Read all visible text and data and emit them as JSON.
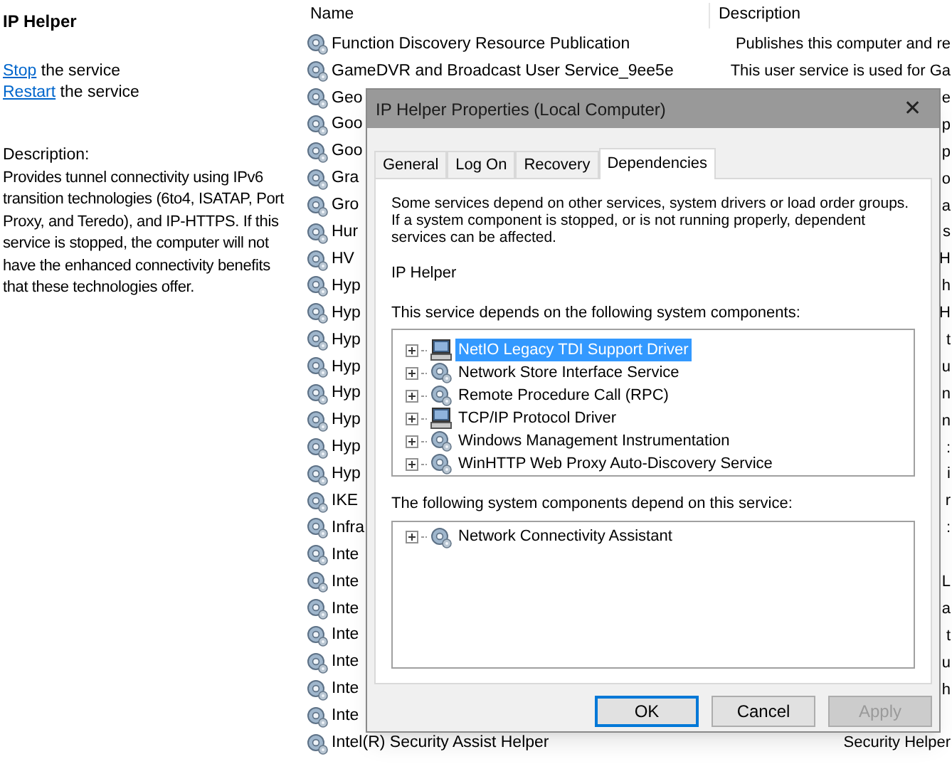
{
  "details": {
    "title": "IP Helper",
    "actions": [
      {
        "link": "Stop",
        "text": "the service"
      },
      {
        "link": "Restart",
        "text": "the service"
      }
    ],
    "description_label": "Description:",
    "description": "Provides tunnel connectivity using IPv6 transition technologies (6to4, ISATAP, Port Proxy, and Teredo), and IP-HTTPS. If this service is stopped, the computer will not have the enhanced connectivity benefits that these technologies offer."
  },
  "services": {
    "columns": [
      "Name",
      "Description"
    ],
    "rows": [
      {
        "name": "Function Discovery Resource Publication",
        "description": "Publishes this computer and re"
      },
      {
        "name": "GameDVR and Broadcast User Service_9ee5e",
        "description": "This user service is used for Ga"
      },
      {
        "name": "Geo",
        "description": "e"
      },
      {
        "name": "Goo",
        "description": "p"
      },
      {
        "name": "Goo",
        "description": "p"
      },
      {
        "name": "Gra",
        "description": "o"
      },
      {
        "name": "Gro",
        "description": "a"
      },
      {
        "name": "Hur",
        "description": "s"
      },
      {
        "name": "HV",
        "description": "H"
      },
      {
        "name": "Hyp",
        "description": "h"
      },
      {
        "name": "Hyp",
        "description": "H"
      },
      {
        "name": "Hyp",
        "description": "t"
      },
      {
        "name": "Hyp",
        "description": "u"
      },
      {
        "name": "Hyp",
        "description": "n"
      },
      {
        "name": "Hyp",
        "description": "n"
      },
      {
        "name": "Hyp",
        "description": ":"
      },
      {
        "name": "Hyp",
        "description": "i"
      },
      {
        "name": "IKE",
        "description": "r"
      },
      {
        "name": "Infra",
        "description": ":"
      },
      {
        "name": "Inte"
      },
      {
        "name": "Inte",
        "description": "L"
      },
      {
        "name": "Inte",
        "description": "a"
      },
      {
        "name": "Inte",
        "description": "t"
      },
      {
        "name": "Inte",
        "description": "u"
      },
      {
        "name": "Inte",
        "description": "h"
      },
      {
        "name": "Inte"
      },
      {
        "name": "Intel(R) Security Assist Helper",
        "description": "Security Helper"
      }
    ]
  },
  "dialog": {
    "title": "IP Helper Properties (Local Computer)",
    "close": "✕",
    "tabs": [
      {
        "label": "General",
        "selected": false
      },
      {
        "label": "Log On",
        "selected": false
      },
      {
        "label": "Recovery",
        "selected": false
      },
      {
        "label": "Dependencies",
        "selected": true
      }
    ],
    "intro": "Some services depend on other services, system drivers or load order groups. If a system component is stopped, or is not running properly, dependent services can be affected.",
    "service_name": "IP Helper",
    "depends_on_label": "This service depends on the following system components:",
    "depends_on": [
      {
        "kind": "driver",
        "label": "NetIO Legacy TDI Support Driver",
        "selected": true,
        "expanded": false
      },
      {
        "kind": "service",
        "label": "Network Store Interface Service",
        "selected": false,
        "expanded": false
      },
      {
        "kind": "service",
        "label": "Remote Procedure Call (RPC)",
        "selected": false,
        "expanded": false
      },
      {
        "kind": "driver",
        "label": "TCP/IP Protocol Driver",
        "selected": false,
        "expanded": false
      },
      {
        "kind": "service",
        "label": "Windows Management Instrumentation",
        "selected": false,
        "expanded": false
      },
      {
        "kind": "service",
        "label": "WinHTTP Web Proxy Auto-Discovery Service",
        "selected": false,
        "expanded": false
      }
    ],
    "dependents_label": "The following system components depend on this service:",
    "dependents": [
      {
        "kind": "service",
        "label": "Network Connectivity Assistant",
        "selected": false,
        "expanded": false
      }
    ],
    "buttons": [
      {
        "label": "OK",
        "default": true,
        "disabled": false
      },
      {
        "label": "Cancel",
        "default": false,
        "disabled": false
      },
      {
        "label": "Apply",
        "default": false,
        "disabled": true
      }
    ]
  }
}
